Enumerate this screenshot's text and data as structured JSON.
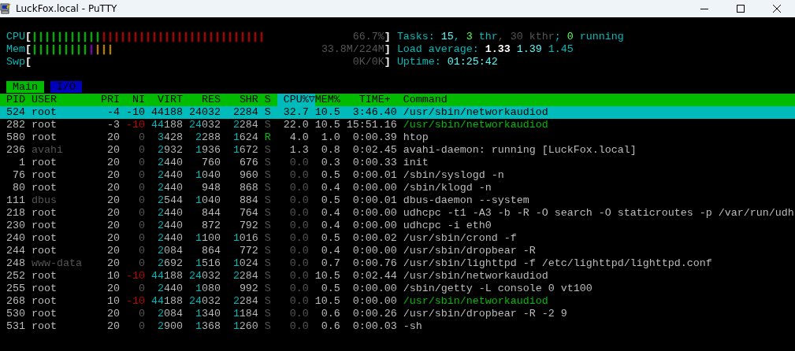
{
  "window": {
    "title": "LuckFox.local - PuTTY"
  },
  "meters": [
    {
      "label": "CPU",
      "bracket_open": "[",
      "value": "66.7%",
      "bracket_close": "]",
      "segments": [
        {
          "color": "#00bb00",
          "text": "|||||||||||"
        },
        {
          "color": "#bb0000",
          "text": "||||||||||||||||||||||||||"
        }
      ]
    },
    {
      "label": "Mem",
      "bracket_open": "[",
      "value": "33.8M/224M",
      "bracket_close": "]",
      "segments": [
        {
          "color": "#00bb00",
          "text": "|||||||||"
        },
        {
          "color": "#8800bb",
          "text": "|"
        },
        {
          "color": "#bb8800",
          "text": "|||"
        }
      ]
    },
    {
      "label": "Swp",
      "bracket_open": "[",
      "value": "0K/0K",
      "bracket_close": "]"
    }
  ],
  "summary": [
    [
      {
        "text": "Tasks:",
        "kind": "label"
      },
      {
        "text": "15",
        "kind": "value"
      },
      {
        "text": ",",
        "kind": "label"
      },
      {
        "text": "3",
        "kind": "green"
      },
      {
        "text": "thr",
        "kind": "label"
      },
      {
        "text": ", 30 kthr",
        "kind": "dim"
      },
      {
        "text": ";",
        "kind": "label"
      },
      {
        "text": "0",
        "kind": "green"
      },
      {
        "text": "running",
        "kind": "label"
      }
    ],
    [
      {
        "text": "Load average:",
        "kind": "label"
      },
      {
        "text": "1.33",
        "kind": "bold"
      },
      {
        "text": "1.39",
        "kind": "value"
      },
      {
        "text": "1.45",
        "kind": "label"
      }
    ],
    [
      {
        "text": "Uptime:",
        "kind": "label"
      },
      {
        "text": "01:25:42",
        "kind": "value"
      }
    ]
  ],
  "tabs": [
    {
      "label": "Main",
      "selected": true
    },
    {
      "label": "I/O",
      "selected": false
    }
  ],
  "table": {
    "columns": [
      {
        "label": "PID",
        "sorted": false
      },
      {
        "label": "USER",
        "sorted": false
      },
      {
        "label": "PRI",
        "sorted": false
      },
      {
        "label": "NI",
        "sorted": false
      },
      {
        "label": "VIRT",
        "sorted": false
      },
      {
        "label": "RES",
        "sorted": false
      },
      {
        "label": "SHR",
        "sorted": false
      },
      {
        "label": "S",
        "sorted": false
      },
      {
        "label": "CPU%▽",
        "sorted": true
      },
      {
        "label": "MEM%",
        "sorted": false
      },
      {
        "label": "TIME+",
        "sorted": false
      },
      {
        "label": "Command",
        "sorted": false
      }
    ],
    "rows": [
      {
        "selected": true,
        "dimmed": false,
        "running": false,
        "thread": false,
        "cells": [
          "524",
          "root",
          "-4",
          "-10",
          "44188",
          "24032",
          "2284",
          "S",
          "32.7",
          "10.5",
          "3:46.40",
          "/usr/sbin/networkaudiod"
        ]
      },
      {
        "selected": false,
        "dimmed": false,
        "running": false,
        "thread": true,
        "cells": [
          "282",
          "root",
          "-3",
          "-10",
          "44188",
          "24032",
          "2284",
          "S",
          "22.0",
          "10.5",
          "15:51.16",
          "/usr/sbin/networkaudiod"
        ]
      },
      {
        "selected": false,
        "dimmed": false,
        "running": true,
        "thread": false,
        "cells": [
          "580",
          "root",
          "20",
          "0",
          "3428",
          "2288",
          "1624",
          "R",
          "4.0",
          "1.0",
          "0:00.39",
          "htop"
        ]
      },
      {
        "selected": false,
        "dimmed": true,
        "running": false,
        "thread": false,
        "cells": [
          "236",
          "avahi",
          "20",
          "0",
          "2932",
          "1936",
          "1672",
          "S",
          "1.3",
          "0.8",
          "0:02.45",
          "avahi-daemon: running [LuckFox.local]"
        ]
      },
      {
        "selected": false,
        "dimmed": false,
        "running": false,
        "thread": false,
        "cells": [
          "1",
          "root",
          "20",
          "0",
          "2440",
          "760",
          "676",
          "S",
          "0.0",
          "0.3",
          "0:00.33",
          "init"
        ]
      },
      {
        "selected": false,
        "dimmed": false,
        "running": false,
        "thread": false,
        "cells": [
          "76",
          "root",
          "20",
          "0",
          "2440",
          "1040",
          "960",
          "S",
          "0.0",
          "0.5",
          "0:00.01",
          "/sbin/syslogd -n"
        ]
      },
      {
        "selected": false,
        "dimmed": false,
        "running": false,
        "thread": false,
        "cells": [
          "80",
          "root",
          "20",
          "0",
          "2440",
          "948",
          "868",
          "S",
          "0.0",
          "0.4",
          "0:00.00",
          "/sbin/klogd -n"
        ]
      },
      {
        "selected": false,
        "dimmed": true,
        "running": false,
        "thread": false,
        "cells": [
          "111",
          "dbus",
          "20",
          "0",
          "2544",
          "1040",
          "884",
          "S",
          "0.0",
          "0.5",
          "0:00.01",
          "dbus-daemon --system"
        ]
      },
      {
        "selected": false,
        "dimmed": false,
        "running": false,
        "thread": false,
        "cells": [
          "218",
          "root",
          "20",
          "0",
          "2440",
          "844",
          "764",
          "S",
          "0.0",
          "0.4",
          "0:00.00",
          "udhcpc -t1 -A3 -b -R -O search -O staticroutes -p /var/run/udh"
        ]
      },
      {
        "selected": false,
        "dimmed": false,
        "running": false,
        "thread": false,
        "cells": [
          "230",
          "root",
          "20",
          "0",
          "2440",
          "872",
          "792",
          "S",
          "0.0",
          "0.4",
          "0:00.00",
          "udhcpc -i eth0"
        ]
      },
      {
        "selected": false,
        "dimmed": false,
        "running": false,
        "thread": false,
        "cells": [
          "240",
          "root",
          "20",
          "0",
          "2440",
          "1100",
          "1016",
          "S",
          "0.0",
          "0.5",
          "0:00.02",
          "/usr/sbin/crond -f"
        ]
      },
      {
        "selected": false,
        "dimmed": false,
        "running": false,
        "thread": false,
        "cells": [
          "244",
          "root",
          "20",
          "0",
          "2084",
          "864",
          "772",
          "S",
          "0.0",
          "0.4",
          "0:00.00",
          "/usr/sbin/dropbear -R"
        ]
      },
      {
        "selected": false,
        "dimmed": true,
        "running": false,
        "thread": false,
        "cells": [
          "248",
          "www-data",
          "20",
          "0",
          "2692",
          "1516",
          "1024",
          "S",
          "0.0",
          "0.7",
          "0:00.76",
          "/usr/sbin/lighttpd -f /etc/lighttpd/lighttpd.conf"
        ]
      },
      {
        "selected": false,
        "dimmed": false,
        "running": false,
        "thread": false,
        "cells": [
          "252",
          "root",
          "10",
          "-10",
          "44188",
          "24032",
          "2284",
          "S",
          "0.0",
          "10.5",
          "0:02.44",
          "/usr/sbin/networkaudiod"
        ]
      },
      {
        "selected": false,
        "dimmed": false,
        "running": false,
        "thread": false,
        "cells": [
          "255",
          "root",
          "20",
          "0",
          "2440",
          "1080",
          "992",
          "S",
          "0.0",
          "0.5",
          "0:00.00",
          "/sbin/getty -L console 0 vt100"
        ]
      },
      {
        "selected": false,
        "dimmed": false,
        "running": false,
        "thread": true,
        "cells": [
          "268",
          "root",
          "10",
          "-10",
          "44188",
          "24032",
          "2284",
          "S",
          "0.0",
          "10.5",
          "0:00.00",
          "/usr/sbin/networkaudiod"
        ]
      },
      {
        "selected": false,
        "dimmed": false,
        "running": false,
        "thread": false,
        "cells": [
          "530",
          "root",
          "20",
          "0",
          "2084",
          "1340",
          "1184",
          "S",
          "0.0",
          "0.6",
          "0:00.26",
          "/usr/sbin/dropbear -R -2 9"
        ]
      },
      {
        "selected": false,
        "dimmed": false,
        "running": false,
        "thread": false,
        "cells": [
          "531",
          "root",
          "20",
          "0",
          "2900",
          "1368",
          "1260",
          "S",
          "0.0",
          "0.6",
          "0:00.03",
          "-sh"
        ]
      }
    ]
  }
}
